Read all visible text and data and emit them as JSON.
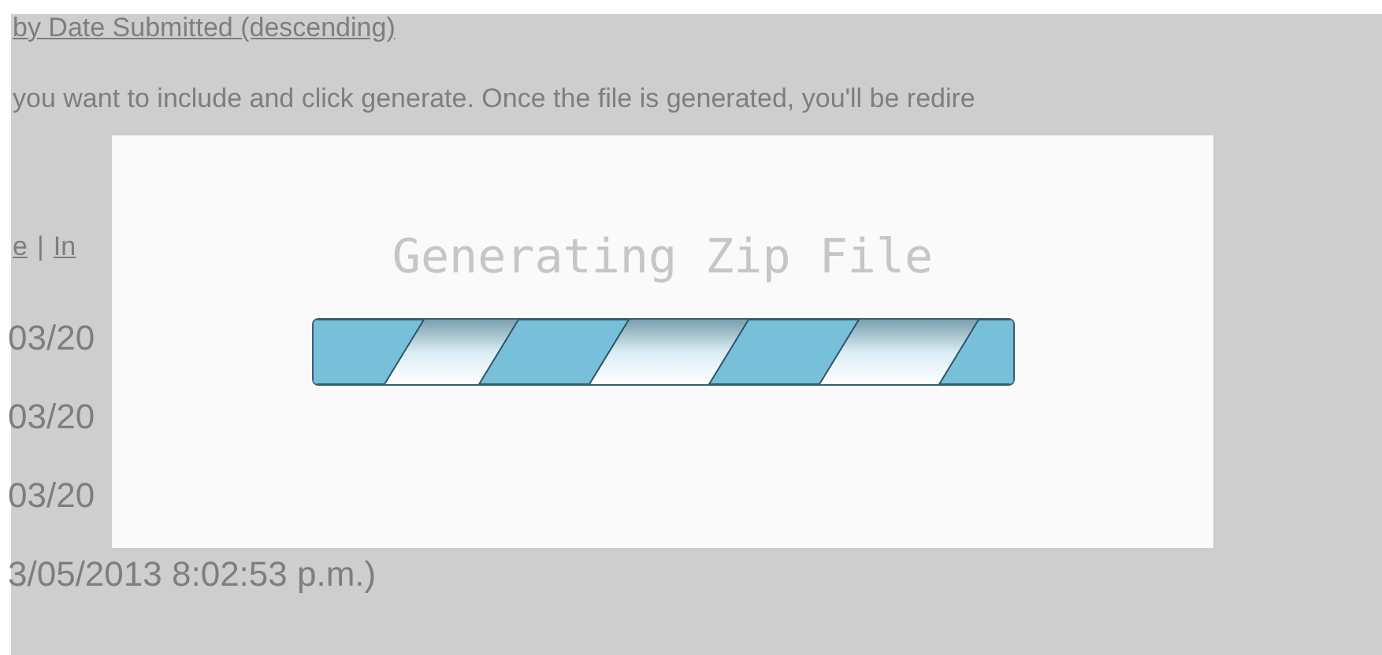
{
  "page": {
    "sort_link": "by Date Submitted (descending)",
    "instructions": "you want to include and click generate. Once the file is generated, you'll be redire",
    "links": [
      {
        "label": "e"
      },
      {
        "label": "In"
      }
    ],
    "separator": "|",
    "rows": [
      "03/20",
      "03/20",
      "03/20",
      "3/05/2013 8:02:53 p.m.)"
    ]
  },
  "dialog": {
    "title": "Generating Zip File",
    "progress": {
      "level": 1
    }
  }
}
